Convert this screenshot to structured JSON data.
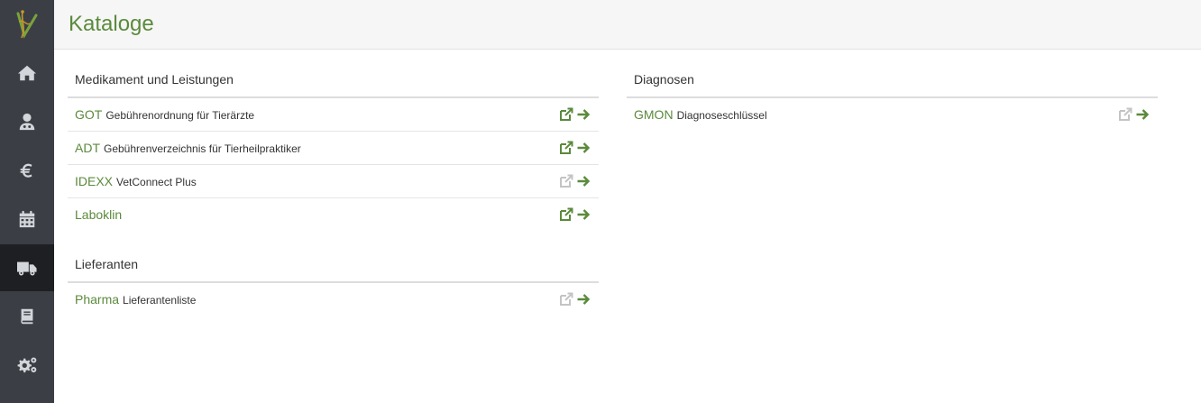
{
  "colors": {
    "accent": "#5b8a3c",
    "sidebar": "#3b3f45",
    "sidebar_active": "#1d1f22",
    "icon_disabled": "#c4c4c4"
  },
  "sidebar": {
    "items": [
      {
        "icon": "home-icon",
        "active": false
      },
      {
        "icon": "user-doctor-icon",
        "active": false
      },
      {
        "icon": "euro-icon",
        "active": false
      },
      {
        "icon": "calendar-icon",
        "active": false
      },
      {
        "icon": "truck-icon",
        "active": true
      },
      {
        "icon": "book-icon",
        "active": false
      },
      {
        "icon": "gears-icon",
        "active": false
      }
    ]
  },
  "header": {
    "title": "Kataloge"
  },
  "sections": {
    "medikament": {
      "title": "Medikament und Leistungen",
      "rows": [
        {
          "code": "GOT",
          "desc": "Gebührenordnung für Tierärzte",
          "external_active": true
        },
        {
          "code": "ADT",
          "desc": "Gebührenverzeichnis für Tierheilpraktiker",
          "external_active": true
        },
        {
          "code": "IDEXX",
          "desc": "VetConnect Plus",
          "external_active": false
        },
        {
          "code": "Laboklin",
          "desc": "",
          "external_active": true
        }
      ]
    },
    "lieferanten": {
      "title": "Lieferanten",
      "rows": [
        {
          "code": "Pharma",
          "desc": "Lieferantenliste",
          "external_active": false
        }
      ]
    },
    "diagnosen": {
      "title": "Diagnosen",
      "rows": [
        {
          "code": "GMON",
          "desc": "Diagnoseschlüssel",
          "external_active": false
        }
      ]
    }
  }
}
